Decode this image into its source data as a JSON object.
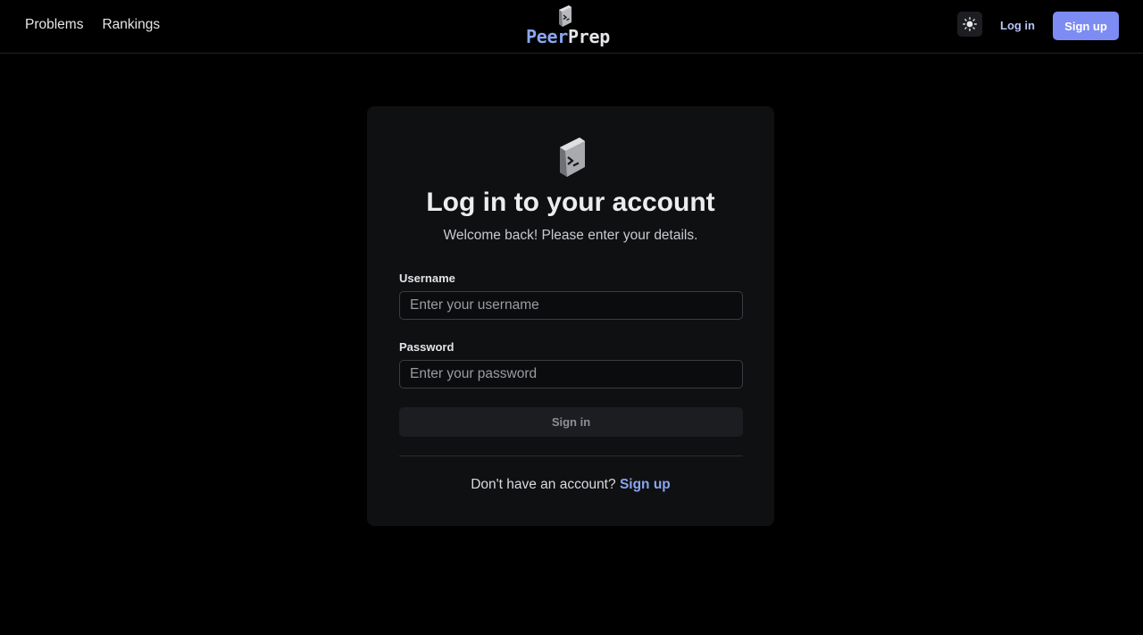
{
  "nav": {
    "links": [
      "Problems",
      "Rankings"
    ],
    "brand_peer": "Peer",
    "brand_prep": "Prep",
    "theme_icon": "sun-icon",
    "login_label": "Log in",
    "signup_label": "Sign up"
  },
  "card": {
    "logo_icon": "terminal-cube-icon",
    "title": "Log in to your account",
    "subtitle": "Welcome back! Please enter your details.",
    "username_label": "Username",
    "username_placeholder": "Enter your username",
    "password_label": "Password",
    "password_placeholder": "Enter your password",
    "signin_label": "Sign in",
    "footer_text": "Don't have an account?",
    "footer_link": "Sign up"
  },
  "colors": {
    "accent": "#7c8cf3",
    "link": "#8aa6f0",
    "background": "#000000",
    "card": "#0f1012"
  }
}
